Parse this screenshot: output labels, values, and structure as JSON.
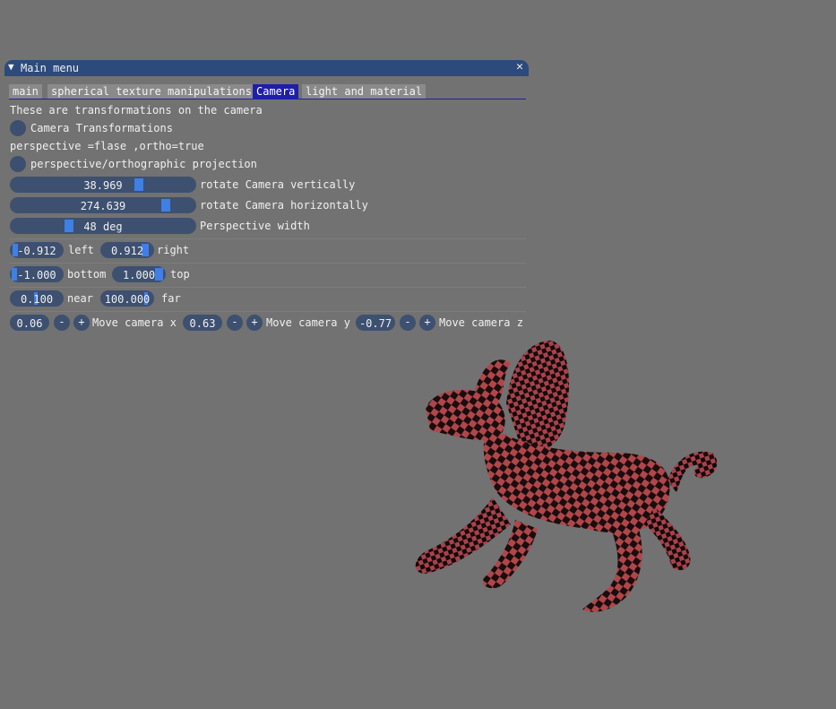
{
  "window": {
    "title": "Main menu",
    "collapse_icon": "▼",
    "close_icon": "✕"
  },
  "tabs": [
    {
      "label": "main"
    },
    {
      "label": "spherical texture manipulations"
    },
    {
      "label": "Camera"
    },
    {
      "label": "light and material"
    }
  ],
  "camera": {
    "description": "These are transformations on the camera",
    "radio_camera_transformations": "Camera Transformations",
    "projection_note": "perspective =flase ,ortho=true",
    "radio_projection": "perspective/orthographic projection",
    "sliders": [
      {
        "value": "38.969",
        "label": "rotate Camera vertically",
        "fraction": 0.706
      },
      {
        "value": "274.639",
        "label": "rotate Camera horizontally",
        "fraction": 0.863
      },
      {
        "value": "48 deg",
        "label": "Perspective width",
        "fraction": 0.303
      }
    ],
    "left": {
      "value": "-0.912",
      "label": "left"
    },
    "right": {
      "value": "0.912",
      "label": "right"
    },
    "bottom": {
      "value": "-1.000",
      "label": "bottom"
    },
    "top": {
      "value": "1.000",
      "label": "top"
    },
    "near": {
      "value": "0.100",
      "label": "near"
    },
    "far": {
      "value": "100.000",
      "label": "far"
    },
    "move": [
      {
        "value": "0.06",
        "label": "Move camera x"
      },
      {
        "value": "0.63",
        "label": "Move camera y"
      },
      {
        "value": "-0.77",
        "label": "Move camera z"
      }
    ],
    "minus": "-",
    "plus": "+"
  },
  "colors": {
    "background": "#727272",
    "title_bar": "#2c4a7c",
    "active_tab": "#1e1ea8",
    "slider_grab": "#3f7fe6",
    "frame_bg": "#3d5070",
    "model_red": "#b0464a"
  }
}
